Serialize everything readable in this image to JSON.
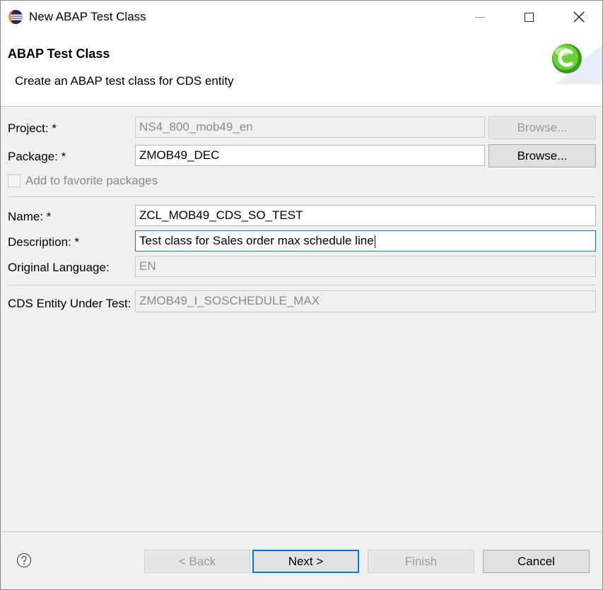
{
  "window": {
    "title": "New ABAP Test Class"
  },
  "header": {
    "title": "ABAP Test Class",
    "description": "Create an ABAP test class for CDS entity"
  },
  "form": {
    "project": {
      "label": "Project: *",
      "value": "NS4_800_mob49_en",
      "browse_label": "Browse..."
    },
    "package": {
      "label": "Package: *",
      "value": "ZMOB49_DEC",
      "browse_label": "Browse..."
    },
    "favorites": {
      "label": "Add to favorite packages",
      "checked": false
    },
    "name": {
      "label": "Name: *",
      "value": "ZCL_MOB49_CDS_SO_TEST"
    },
    "description": {
      "label": "Description: *",
      "value": "Test class for Sales order max schedule line"
    },
    "language": {
      "label": "Original Language:",
      "value": "EN"
    },
    "cds_entity": {
      "label": "CDS Entity Under Test:",
      "value": "ZMOB49_I_SOSCHEDULE_MAX"
    }
  },
  "footer": {
    "back_label": "< Back",
    "next_label": "Next >",
    "finish_label": "Finish",
    "cancel_label": "Cancel"
  },
  "icons": {
    "app": "eclipse-icon",
    "help": "help-icon",
    "logo": "abap-class-wizard-icon"
  },
  "colors": {
    "accent": "#0078d7",
    "logo_green": "#5fbf2a"
  }
}
